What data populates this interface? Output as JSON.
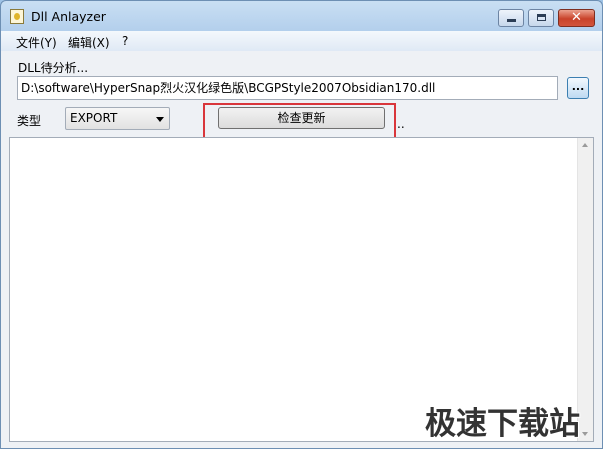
{
  "window": {
    "title": "Dll Anlayzer"
  },
  "menu": {
    "items": [
      "文件(Y)",
      "编辑(X)",
      "?"
    ]
  },
  "form": {
    "dll_label": "DLL待分析...",
    "dll_path": "D:\\software\\HyperSnap烈火汉化绿色版\\BCGPStyle2007Obsidian170.dll",
    "browse_label": "...",
    "type_label": "类型",
    "type_value": "EXPORT",
    "check_button": "检查更新",
    "trailing_dots": ".."
  },
  "watermark": "极速下载站",
  "colors": {
    "highlight": "#d9363b",
    "close_button": "#c9432a"
  }
}
